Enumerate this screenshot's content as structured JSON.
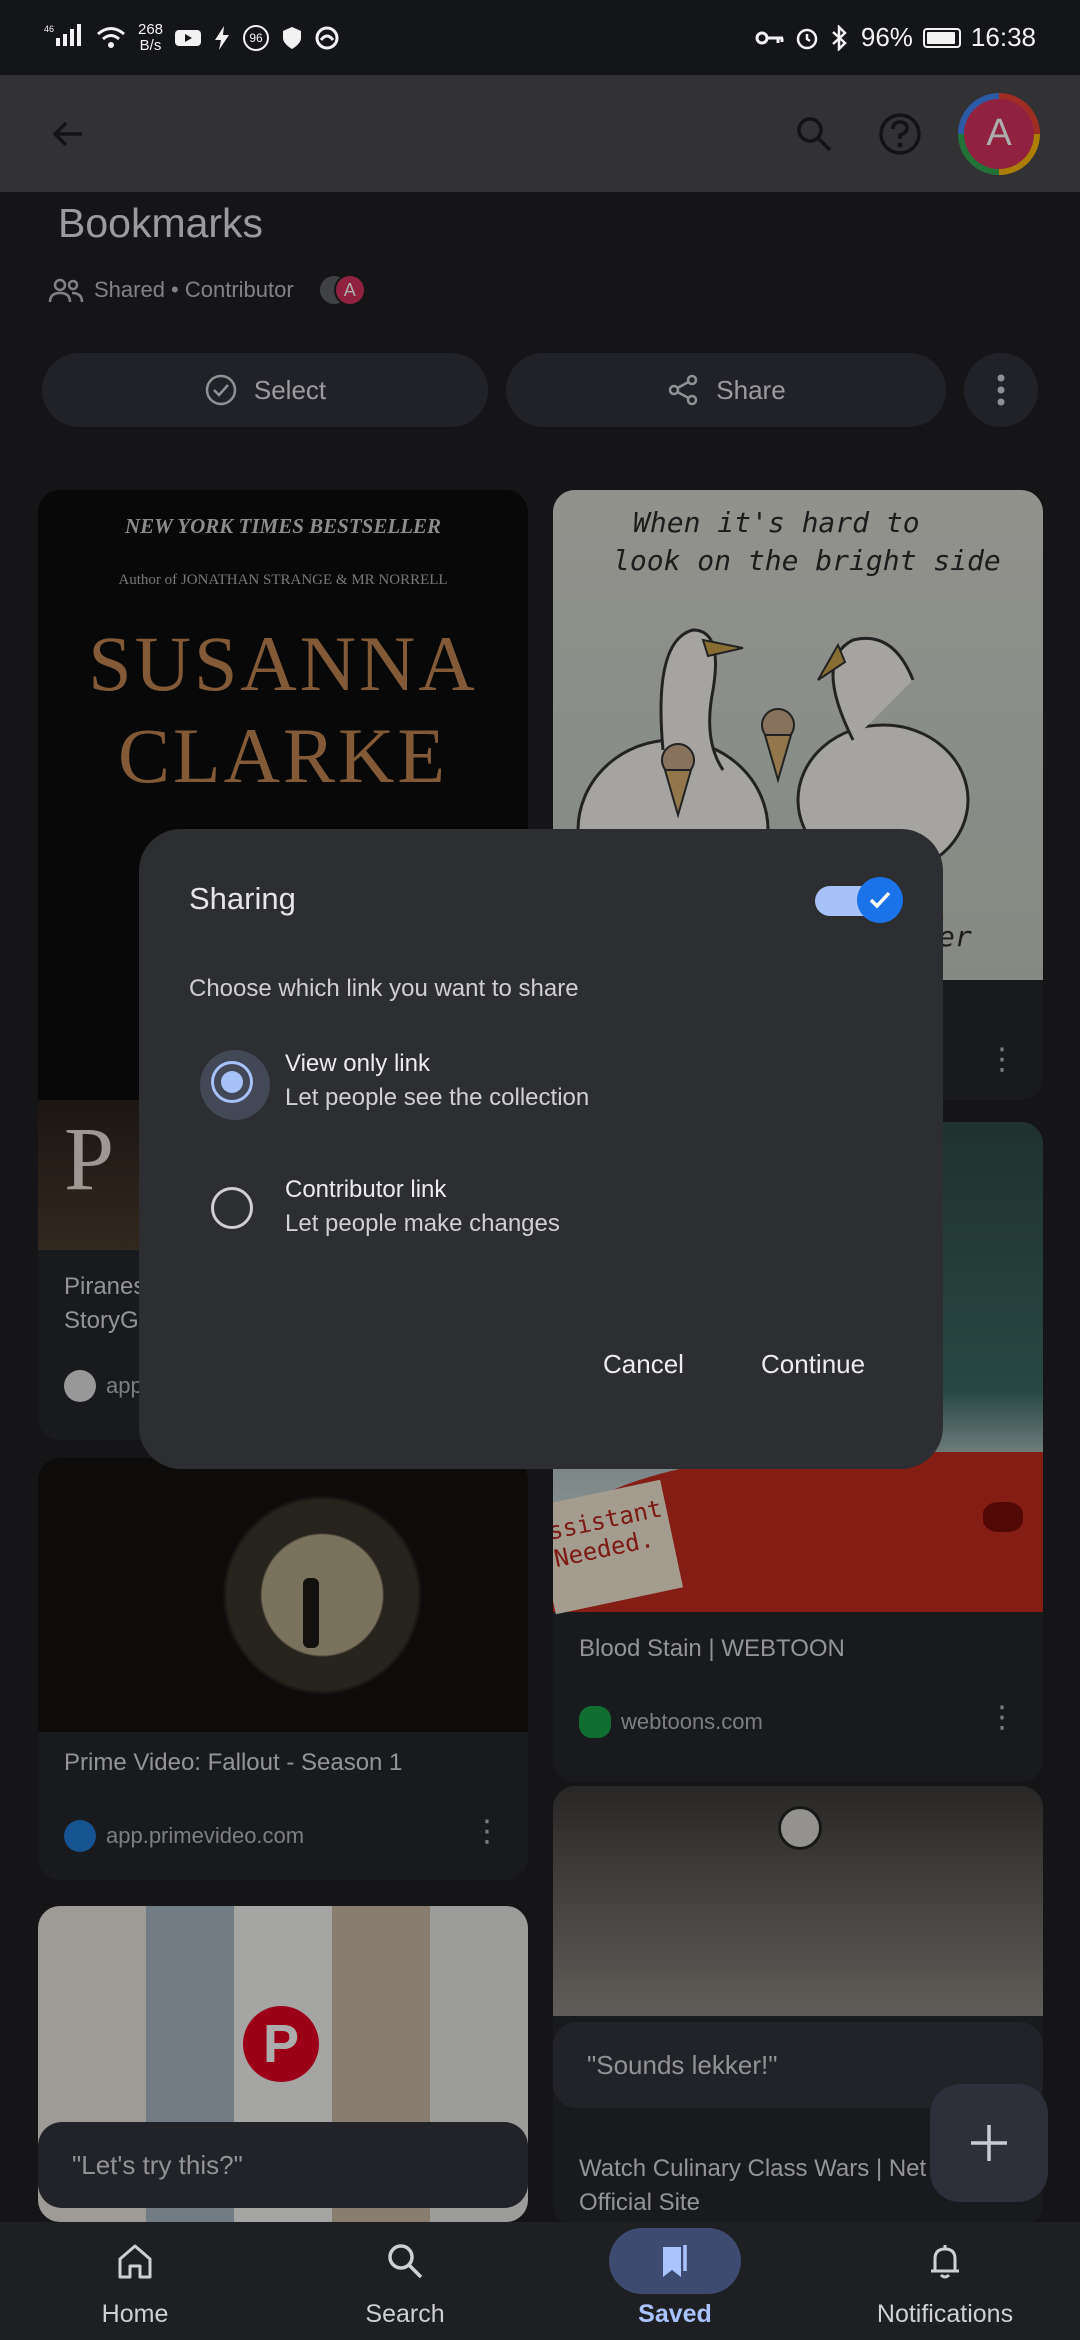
{
  "status_bar": {
    "signal": "46",
    "net_speed": "268",
    "net_unit": "B/s",
    "badge": "96",
    "battery_text": "96%",
    "time": "16:38"
  },
  "app_bar": {
    "avatar_letter": "A"
  },
  "collection": {
    "title": "Bookmarks",
    "meta": "Shared • Contributor",
    "member_initial": "A"
  },
  "actions": {
    "select_label": "Select",
    "share_label": "Share"
  },
  "cards": {
    "book": {
      "bestseller": "NEW YORK TIMES BESTSELLER",
      "author_line": "Author of JONATHAN STRANGE & MR NORRELL",
      "author": [
        "SUSANNA",
        "CLARKE"
      ],
      "title_lines": [
        "Piranes",
        "StoryG"
      ],
      "source": "app"
    },
    "comic": {
      "caption_lines": [
        "When it's hard to",
        "look on the bright side"
      ],
      "tail_text": "er"
    },
    "fallout": {
      "title": "Prime Video: Fallout - Season 1",
      "source": "app.primevideo.com"
    },
    "webtoon": {
      "title": "Blood Stain | WEBTOON",
      "source": "webtoons.com",
      "sign_text": [
        "ssistant",
        "Needed."
      ]
    },
    "pinterest": {
      "note": "\"Let's try this?\""
    },
    "culinary": {
      "note": "\"Sounds lekker!\"",
      "title_lines": [
        "Watch Culinary Class Wars | Net",
        "Official Site"
      ]
    }
  },
  "dialog": {
    "title": "Sharing",
    "toggle_on": true,
    "prompt": "Choose which link you want to share",
    "options": [
      {
        "title": "View only link",
        "desc": "Let people see the collection",
        "selected": true
      },
      {
        "title": "Contributor link",
        "desc": "Let people make changes",
        "selected": false
      }
    ],
    "cancel_label": "Cancel",
    "continue_label": "Continue"
  },
  "bottom_nav": [
    {
      "label": "Home",
      "icon": "home-icon",
      "active": false
    },
    {
      "label": "Search",
      "icon": "search-icon",
      "active": false
    },
    {
      "label": "Saved",
      "icon": "bookmarks-icon",
      "active": true
    },
    {
      "label": "Notifications",
      "icon": "bell-icon",
      "active": false
    }
  ],
  "colors": {
    "accent": "#a7c2f7",
    "toggle_thumb": "#1a73e8",
    "avatar": "#d6335e",
    "active_nav": "#3e4b70"
  }
}
